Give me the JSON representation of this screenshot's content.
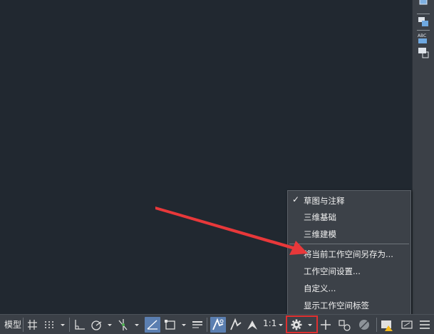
{
  "statusbar": {
    "model_tab": "模型",
    "scale": "1:1"
  },
  "workspace_menu": {
    "items": [
      {
        "label": "草图与注释",
        "checked": true
      },
      {
        "label": "三维基础",
        "checked": false
      },
      {
        "label": "三维建模",
        "checked": false
      },
      {
        "label": "将当前工作空间另存为...",
        "checked": false
      },
      {
        "label": "工作空间设置...",
        "checked": false
      },
      {
        "label": "自定义...",
        "checked": false
      },
      {
        "label": "显示工作空间标签",
        "checked": false
      }
    ],
    "check_glyph": "✓"
  },
  "colors": {
    "canvas": "#212830",
    "toolbar": "#3b4047",
    "menu": "#3c4148",
    "highlight_box": "#e03030",
    "arrow": "#e8383a",
    "active_button": "#5b7fb1"
  }
}
